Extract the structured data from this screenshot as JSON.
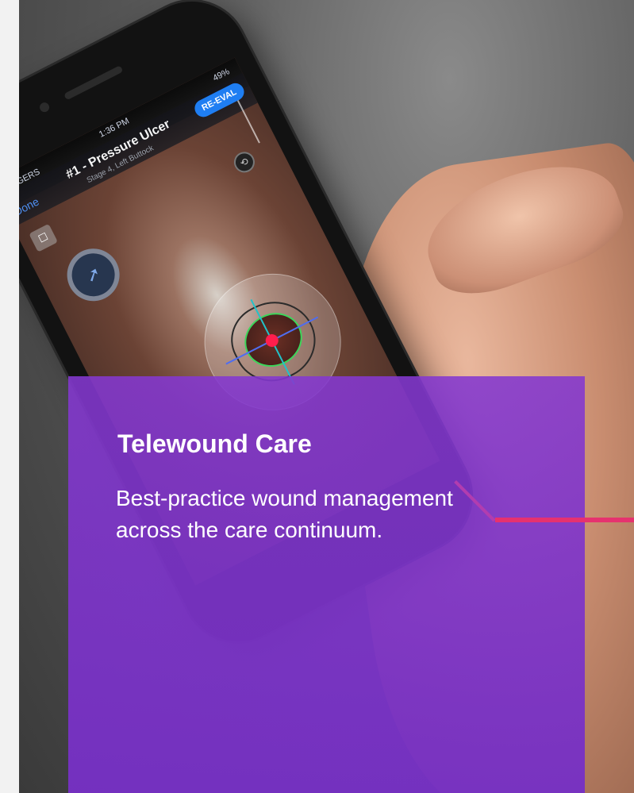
{
  "phone_ui": {
    "status": {
      "carrier": "ROGERS",
      "time": "1:36 PM",
      "battery": "49%"
    },
    "nav": {
      "done_label": "Done",
      "title": "#1 - Pressure Ulcer",
      "subtitle": "Stage 4, Left Buttock",
      "reeval_label": "RE-EVAL"
    }
  },
  "card": {
    "title": "Telewound Care",
    "body": "Best-practice wound management  across the care continuum."
  },
  "colors": {
    "card_purple": "#7a34c6",
    "accent_pink": "#e6326f",
    "reeval_blue": "#1f7ef2"
  }
}
